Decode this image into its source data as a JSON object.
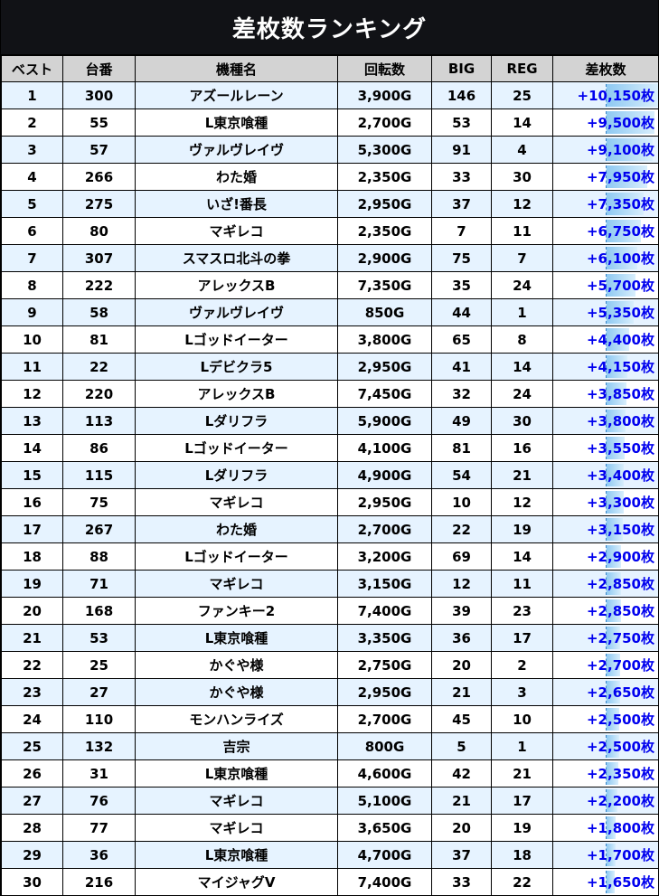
{
  "title": "差枚数ランキング",
  "headers": [
    "ベスト",
    "台番",
    "機種名",
    "回転数",
    "BIG",
    "REG",
    "差枚数"
  ],
  "max_diff": 10150,
  "colors": {
    "header_bg": "#d3d3d3",
    "title_bg": "#111216",
    "odd_row": "#e6f3ff",
    "diff_text": "#0000ee"
  },
  "rows": [
    {
      "rank": "1",
      "machine_no": "300",
      "model": "アズールレーン",
      "spins": "3,900G",
      "big": "146",
      "reg": "25",
      "diff": "+10,150枚",
      "diff_value": 10150
    },
    {
      "rank": "2",
      "machine_no": "55",
      "model": "L東京喰種",
      "spins": "2,700G",
      "big": "53",
      "reg": "14",
      "diff": "+9,500枚",
      "diff_value": 9500
    },
    {
      "rank": "3",
      "machine_no": "57",
      "model": "ヴァルヴレイヴ",
      "spins": "5,300G",
      "big": "91",
      "reg": "4",
      "diff": "+9,100枚",
      "diff_value": 9100
    },
    {
      "rank": "4",
      "machine_no": "266",
      "model": "わた婚",
      "spins": "2,350G",
      "big": "33",
      "reg": "30",
      "diff": "+7,950枚",
      "diff_value": 7950
    },
    {
      "rank": "5",
      "machine_no": "275",
      "model": "いざ!番長",
      "spins": "2,950G",
      "big": "37",
      "reg": "12",
      "diff": "+7,350枚",
      "diff_value": 7350
    },
    {
      "rank": "6",
      "machine_no": "80",
      "model": "マギレコ",
      "spins": "2,350G",
      "big": "7",
      "reg": "11",
      "diff": "+6,750枚",
      "diff_value": 6750
    },
    {
      "rank": "7",
      "machine_no": "307",
      "model": "スマスロ北斗の拳",
      "spins": "2,900G",
      "big": "75",
      "reg": "7",
      "diff": "+6,100枚",
      "diff_value": 6100
    },
    {
      "rank": "8",
      "machine_no": "222",
      "model": "アレックスB",
      "spins": "7,350G",
      "big": "35",
      "reg": "24",
      "diff": "+5,700枚",
      "diff_value": 5700
    },
    {
      "rank": "9",
      "machine_no": "58",
      "model": "ヴァルヴレイヴ",
      "spins": "850G",
      "big": "44",
      "reg": "1",
      "diff": "+5,350枚",
      "diff_value": 5350
    },
    {
      "rank": "10",
      "machine_no": "81",
      "model": "Lゴッドイーター",
      "spins": "3,800G",
      "big": "65",
      "reg": "8",
      "diff": "+4,400枚",
      "diff_value": 4400
    },
    {
      "rank": "11",
      "machine_no": "22",
      "model": "Lデビクラ5",
      "spins": "2,950G",
      "big": "41",
      "reg": "14",
      "diff": "+4,150枚",
      "diff_value": 4150
    },
    {
      "rank": "12",
      "machine_no": "220",
      "model": "アレックスB",
      "spins": "7,450G",
      "big": "32",
      "reg": "24",
      "diff": "+3,850枚",
      "diff_value": 3850
    },
    {
      "rank": "13",
      "machine_no": "113",
      "model": "Lダリフラ",
      "spins": "5,900G",
      "big": "49",
      "reg": "30",
      "diff": "+3,800枚",
      "diff_value": 3800
    },
    {
      "rank": "14",
      "machine_no": "86",
      "model": "Lゴッドイーター",
      "spins": "4,100G",
      "big": "81",
      "reg": "16",
      "diff": "+3,550枚",
      "diff_value": 3550
    },
    {
      "rank": "15",
      "machine_no": "115",
      "model": "Lダリフラ",
      "spins": "4,900G",
      "big": "54",
      "reg": "21",
      "diff": "+3,400枚",
      "diff_value": 3400
    },
    {
      "rank": "16",
      "machine_no": "75",
      "model": "マギレコ",
      "spins": "2,950G",
      "big": "10",
      "reg": "12",
      "diff": "+3,300枚",
      "diff_value": 3300
    },
    {
      "rank": "17",
      "machine_no": "267",
      "model": "わた婚",
      "spins": "2,700G",
      "big": "22",
      "reg": "19",
      "diff": "+3,150枚",
      "diff_value": 3150
    },
    {
      "rank": "18",
      "machine_no": "88",
      "model": "Lゴッドイーター",
      "spins": "3,200G",
      "big": "69",
      "reg": "14",
      "diff": "+2,900枚",
      "diff_value": 2900
    },
    {
      "rank": "19",
      "machine_no": "71",
      "model": "マギレコ",
      "spins": "3,150G",
      "big": "12",
      "reg": "11",
      "diff": "+2,850枚",
      "diff_value": 2850
    },
    {
      "rank": "20",
      "machine_no": "168",
      "model": "ファンキー2",
      "spins": "7,400G",
      "big": "39",
      "reg": "23",
      "diff": "+2,850枚",
      "diff_value": 2850
    },
    {
      "rank": "21",
      "machine_no": "53",
      "model": "L東京喰種",
      "spins": "3,350G",
      "big": "36",
      "reg": "17",
      "diff": "+2,750枚",
      "diff_value": 2750
    },
    {
      "rank": "22",
      "machine_no": "25",
      "model": "かぐや様",
      "spins": "2,750G",
      "big": "20",
      "reg": "2",
      "diff": "+2,700枚",
      "diff_value": 2700
    },
    {
      "rank": "23",
      "machine_no": "27",
      "model": "かぐや様",
      "spins": "2,950G",
      "big": "21",
      "reg": "3",
      "diff": "+2,650枚",
      "diff_value": 2650
    },
    {
      "rank": "24",
      "machine_no": "110",
      "model": "モンハンライズ",
      "spins": "2,700G",
      "big": "45",
      "reg": "10",
      "diff": "+2,500枚",
      "diff_value": 2500
    },
    {
      "rank": "25",
      "machine_no": "132",
      "model": "吉宗",
      "spins": "800G",
      "big": "5",
      "reg": "1",
      "diff": "+2,500枚",
      "diff_value": 2500
    },
    {
      "rank": "26",
      "machine_no": "31",
      "model": "L東京喰種",
      "spins": "4,600G",
      "big": "42",
      "reg": "21",
      "diff": "+2,350枚",
      "diff_value": 2350
    },
    {
      "rank": "27",
      "machine_no": "76",
      "model": "マギレコ",
      "spins": "5,100G",
      "big": "21",
      "reg": "17",
      "diff": "+2,200枚",
      "diff_value": 2200
    },
    {
      "rank": "28",
      "machine_no": "77",
      "model": "マギレコ",
      "spins": "3,650G",
      "big": "20",
      "reg": "19",
      "diff": "+1,800枚",
      "diff_value": 1800
    },
    {
      "rank": "29",
      "machine_no": "36",
      "model": "L東京喰種",
      "spins": "4,700G",
      "big": "37",
      "reg": "18",
      "diff": "+1,700枚",
      "diff_value": 1700
    },
    {
      "rank": "30",
      "machine_no": "216",
      "model": "マイジャグV",
      "spins": "7,400G",
      "big": "33",
      "reg": "22",
      "diff": "+1,650枚",
      "diff_value": 1650
    }
  ]
}
